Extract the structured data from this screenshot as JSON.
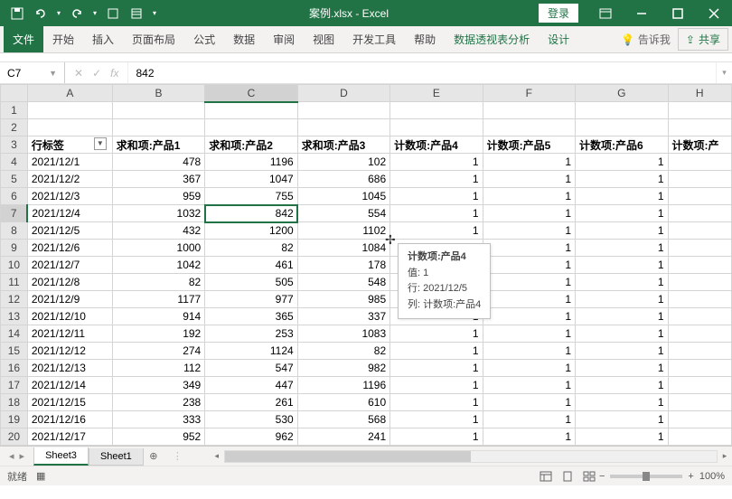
{
  "titlebar": {
    "filename": "案例.xlsx - Excel",
    "login": "登录",
    "qat": {
      "save": "保存",
      "undo": "撤销",
      "redo": "重做"
    }
  },
  "ribbon": {
    "tabs": [
      "文件",
      "开始",
      "插入",
      "页面布局",
      "公式",
      "数据",
      "审阅",
      "视图",
      "开发工具",
      "帮助",
      "数据透视表分析",
      "设计"
    ],
    "tell_me": "告诉我",
    "share": "共享"
  },
  "formula_bar": {
    "namebox": "C7",
    "formula": "842"
  },
  "columns": [
    "A",
    "B",
    "C",
    "D",
    "E",
    "F",
    "G",
    "H"
  ],
  "row_numbers": [
    1,
    2,
    3,
    4,
    5,
    6,
    7,
    8,
    9,
    10,
    11,
    12,
    13,
    14,
    15,
    16,
    17,
    18,
    19,
    20
  ],
  "headers": {
    "A": "行标签",
    "B": "求和项:产品1",
    "C": "求和项:产品2",
    "D": "求和项:产品3",
    "E": "计数项:产品4",
    "F": "计数项:产品5",
    "G": "计数项:产品6",
    "H": "计数项:产"
  },
  "rows": [
    {
      "A": "2021/12/1",
      "B": 478,
      "C": 1196,
      "D": 102,
      "E": 1,
      "F": 1,
      "G": 1
    },
    {
      "A": "2021/12/2",
      "B": 367,
      "C": 1047,
      "D": 686,
      "E": 1,
      "F": 1,
      "G": 1
    },
    {
      "A": "2021/12/3",
      "B": 959,
      "C": 755,
      "D": 1045,
      "E": 1,
      "F": 1,
      "G": 1
    },
    {
      "A": "2021/12/4",
      "B": 1032,
      "C": 842,
      "D": 554,
      "E": 1,
      "F": 1,
      "G": 1
    },
    {
      "A": "2021/12/5",
      "B": 432,
      "C": 1200,
      "D": 1102,
      "E": 1,
      "F": 1,
      "G": 1
    },
    {
      "A": "2021/12/6",
      "B": 1000,
      "C": 82,
      "D": 1084,
      "E": "",
      "F": 1,
      "G": 1
    },
    {
      "A": "2021/12/7",
      "B": 1042,
      "C": 461,
      "D": 178,
      "E": "",
      "F": 1,
      "G": 1
    },
    {
      "A": "2021/12/8",
      "B": 82,
      "C": 505,
      "D": 548,
      "E": "",
      "F": 1,
      "G": 1
    },
    {
      "A": "2021/12/9",
      "B": 1177,
      "C": 977,
      "D": 985,
      "E": "",
      "F": 1,
      "G": 1
    },
    {
      "A": "2021/12/10",
      "B": 914,
      "C": 365,
      "D": 337,
      "E": 1,
      "F": 1,
      "G": 1
    },
    {
      "A": "2021/12/11",
      "B": 192,
      "C": 253,
      "D": 1083,
      "E": 1,
      "F": 1,
      "G": 1
    },
    {
      "A": "2021/12/12",
      "B": 274,
      "C": 1124,
      "D": 82,
      "E": 1,
      "F": 1,
      "G": 1
    },
    {
      "A": "2021/12/13",
      "B": 112,
      "C": 547,
      "D": 982,
      "E": 1,
      "F": 1,
      "G": 1
    },
    {
      "A": "2021/12/14",
      "B": 349,
      "C": 447,
      "D": 1196,
      "E": 1,
      "F": 1,
      "G": 1
    },
    {
      "A": "2021/12/15",
      "B": 238,
      "C": 261,
      "D": 610,
      "E": 1,
      "F": 1,
      "G": 1
    },
    {
      "A": "2021/12/16",
      "B": 333,
      "C": 530,
      "D": 568,
      "E": 1,
      "F": 1,
      "G": 1
    },
    {
      "A": "2021/12/17",
      "B": 952,
      "C": 962,
      "D": 241,
      "E": 1,
      "F": 1,
      "G": 1
    }
  ],
  "tooltip": {
    "title": "计数项:产品4",
    "value_label": "值: 1",
    "row_label": "行: 2021/12/5",
    "col_label": "列: 计数项:产品4"
  },
  "sheets": {
    "active": "Sheet3",
    "list": [
      "Sheet3",
      "Sheet1"
    ]
  },
  "statusbar": {
    "ready": "就绪",
    "zoom": "100%",
    "plus": "+"
  },
  "selected_cell": {
    "row": 7,
    "col": "C"
  }
}
